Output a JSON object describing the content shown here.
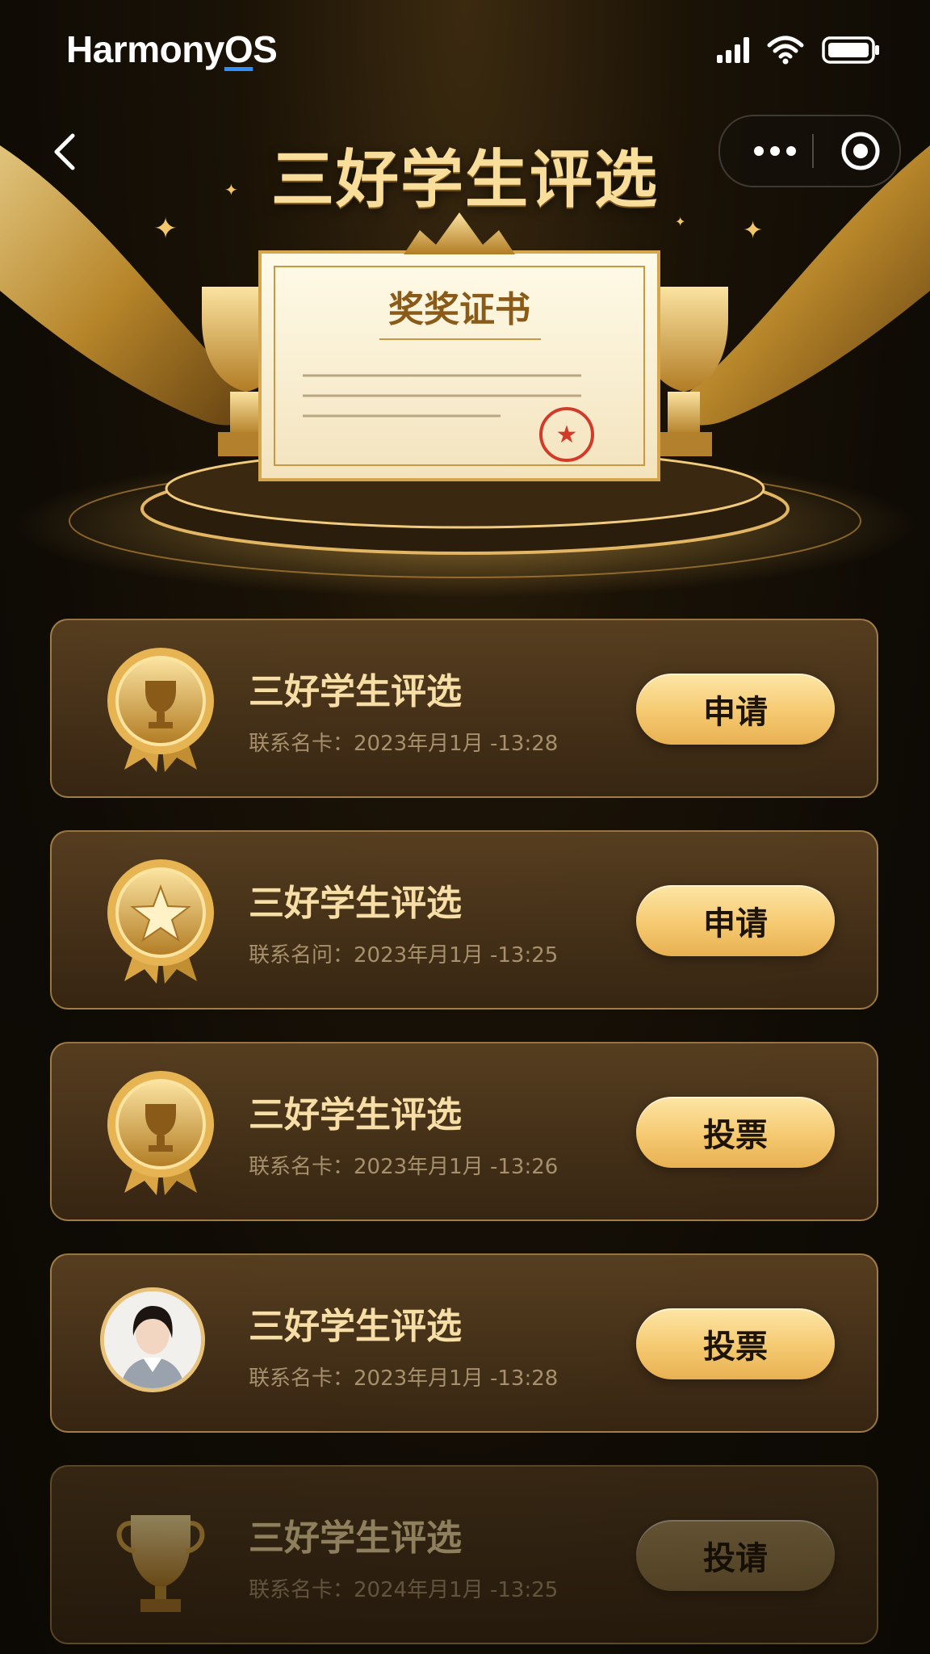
{
  "status_bar": {
    "os_prefix": "Harmony",
    "os_accent": "O",
    "os_suffix": "S",
    "icons": [
      "signal-icon",
      "wifi-icon",
      "battery-icon"
    ]
  },
  "nav": {
    "title": "三好学生评选",
    "back_icon": "chevron-left-icon",
    "more_icon": "more-dots-icon",
    "close_icon": "target-circle-icon"
  },
  "hero": {
    "certificate_title": "奖奖证书"
  },
  "colors": {
    "accent_gold": "#f5c970",
    "title_gold": "#f9de9b",
    "background": "#0f0b05"
  },
  "cards": [
    {
      "title": "三好学生评选",
      "subtitle": "联系名卡：2023年月1月 -13:28",
      "action": "申请",
      "icon": "trophy-medal-icon"
    },
    {
      "title": "三好学生评选",
      "subtitle": "联系名问：2023年月1月 -13:25",
      "action": "申请",
      "icon": "star-medal-icon"
    },
    {
      "title": "三好学生评选",
      "subtitle": "联系名卡：2023年月1月 -13:26",
      "action": "投票",
      "icon": "trophy-medal-icon"
    },
    {
      "title": "三好学生评选",
      "subtitle": "联系名卡：2023年月1月 -13:28",
      "action": "投票",
      "icon": "avatar-photo"
    },
    {
      "title": "三好学生评选",
      "subtitle": "联系名卡：2024年月1月 -13:25",
      "action": "投请",
      "icon": "trophy-icon"
    }
  ]
}
